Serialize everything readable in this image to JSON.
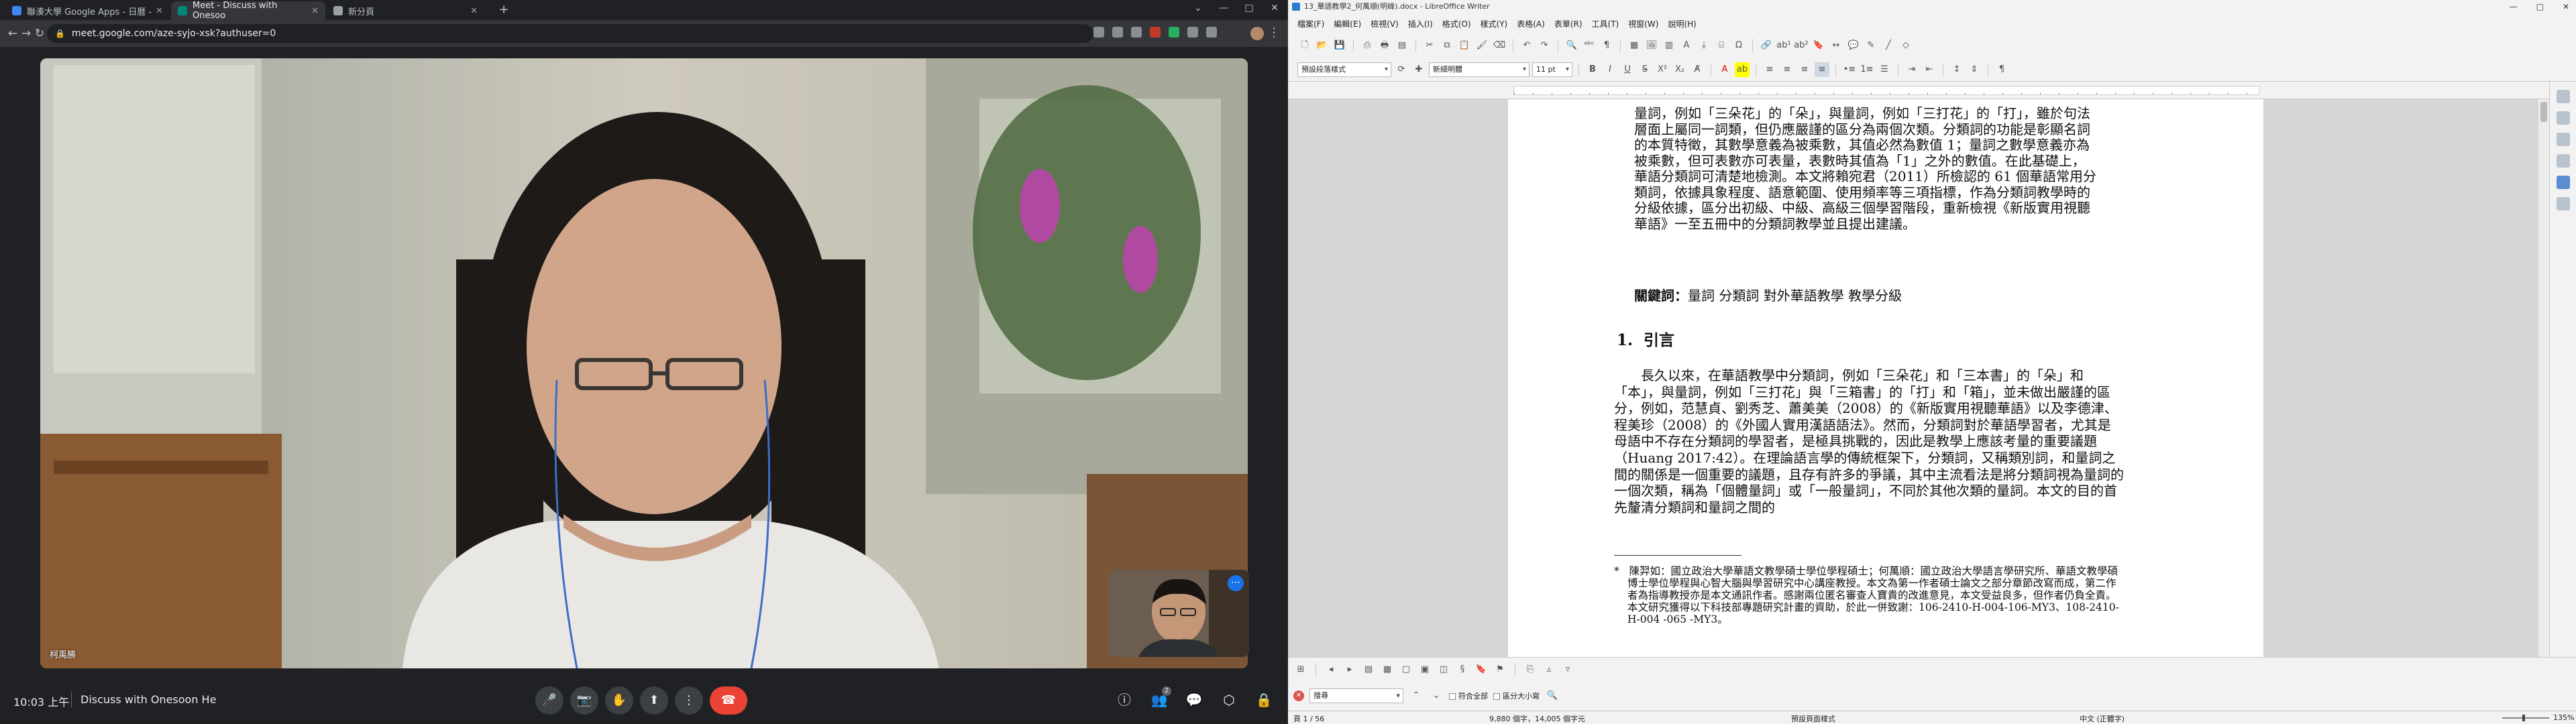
{
  "chrome": {
    "tabs": [
      {
        "title": "聯湊大學 Google Apps - 日曆 -",
        "active": false,
        "favcolor": "#4285f4"
      },
      {
        "title": "Meet - Discuss with Onesoo",
        "active": true,
        "favcolor": "#00897b"
      },
      {
        "title": "新分頁",
        "active": false,
        "favcolor": "#9aa0a6"
      }
    ],
    "new_tab_icon": "plus-icon",
    "url": "meet.google.com/aze-syjo-xsk?authuser=0",
    "window_controls": [
      "⌄",
      "—",
      "□",
      "✕"
    ]
  },
  "meet": {
    "main_participant_name": "柯禹勝",
    "self_view": "self-camera",
    "time": "10:03 上午",
    "meeting_name": "Discuss with Onesoon He",
    "controls": [
      {
        "name": "mic-button",
        "icon": "🎤"
      },
      {
        "name": "camera-button",
        "icon": "📷"
      },
      {
        "name": "raise-hand-button",
        "icon": "✋"
      },
      {
        "name": "present-button",
        "icon": "⬆"
      },
      {
        "name": "more-options-button",
        "icon": "⋮"
      }
    ],
    "end_call_icon": "☎",
    "right_controls": [
      {
        "name": "info-button",
        "icon": "ⓘ"
      },
      {
        "name": "people-button",
        "icon": "👥",
        "badge": "2"
      },
      {
        "name": "chat-button",
        "icon": "💬"
      },
      {
        "name": "activities-button",
        "icon": "⬡"
      },
      {
        "name": "host-controls-button",
        "icon": "🔒"
      }
    ]
  },
  "writer": {
    "window_title": "13_華語教學2_何萬順(明峰).docx - LibreOffice Writer",
    "menu": [
      "檔案(F)",
      "編輯(E)",
      "檢視(V)",
      "插入(I)",
      "格式(O)",
      "樣式(Y)",
      "表格(A)",
      "表單(R)",
      "工具(T)",
      "視窗(W)",
      "說明(H)"
    ],
    "paragraph_style": "預設段落樣式",
    "font_name": "新細明體",
    "font_size": "11 pt",
    "abstract": "量詞，例如「三朵花」的「朵」，與量詞，例如「三打花」的「打」，雖於句法層面上屬同一詞類，但仍應嚴謹的區分為兩個次類。分類詞的功能是彰顯名詞的本質特徵，其數學意義為被乘數，其值必然為數值 1；量詞之數學意義亦為被乘數，但可表數亦可表量，表數時其值為「1」之外的數值。在此基礎上，華語分類詞可清楚地檢測。本文將賴宛君（2011）所檢認的 61 個華語常用分類詞，依據具象程度、語意範圍、使用頻率等三項指標，作為分類詞教學時的分級依據，區分出初級、中級、高級三個學習階段，重新檢視《新版實用視聽華語》一至五冊中的分類詞教學並且提出建議。",
    "keywords_label": "關鍵詞：",
    "keywords": "量詞 分類詞 對外華語教學 教學分級",
    "heading_number": "1.",
    "heading_text": "引言",
    "body": "長久以來，在華語教學中分類詞，例如「三朵花」和「三本書」的「朵」和「本」，與量詞，例如「三打花」與「三箱書」的「打」和「箱」，並未做出嚴謹的區分，例如，范慧貞、劉秀芝、蕭美美（2008）的《新版實用視聽華語》以及李德津、程美珍（2008）的《外國人實用漢語語法》。然而，分類詞對於華語學習者，尤其是母語中不存在分類詞的學習者，是極具挑戰的，因此是教學上應該考量的重要議題（Huang 2017:42）。在理論語言學的傳統框架下，分類詞，又稱類別詞，和量詞之間的關係是一個重要的議題，且存有許多的爭議，其中主流看法是將分類詞視為量詞的一個次類，稱為「個體量詞」或「一般量詞」，不同於其他次類的量詞。本文的目的首先釐清分類詞和量詞之間的",
    "footnote_mark": "*",
    "footnote": "陳羿如：國立政治大學華語文教學碩士學位學程碩士；何萬順：國立政治大學語言學研究所、華語文教學碩博士學位學程與心智大腦與學習研究中心講座教授。本文為第一作者碩士論文之部分章節改寫而成，第二作者為指導教授亦是本文通訊作者。感謝兩位匿名審查人寶貴的改進意見，本文受益良多，但作者仍負全責。本文研究獲得以下科技部專題研究計畫的資助，於此一併致謝：106-2410-H-004-106-MY3、108-2410-H-004 -065 -MY3。",
    "find_placeholder": "搜尋",
    "find_options": [
      "符合全部",
      "區分大小寫"
    ],
    "status": {
      "page": "頁 1 / 56",
      "words": "9,880 個字，14,005 個字元",
      "style": "預設頁面樣式",
      "language": "中文 (正體字)",
      "zoom": "135%"
    }
  }
}
